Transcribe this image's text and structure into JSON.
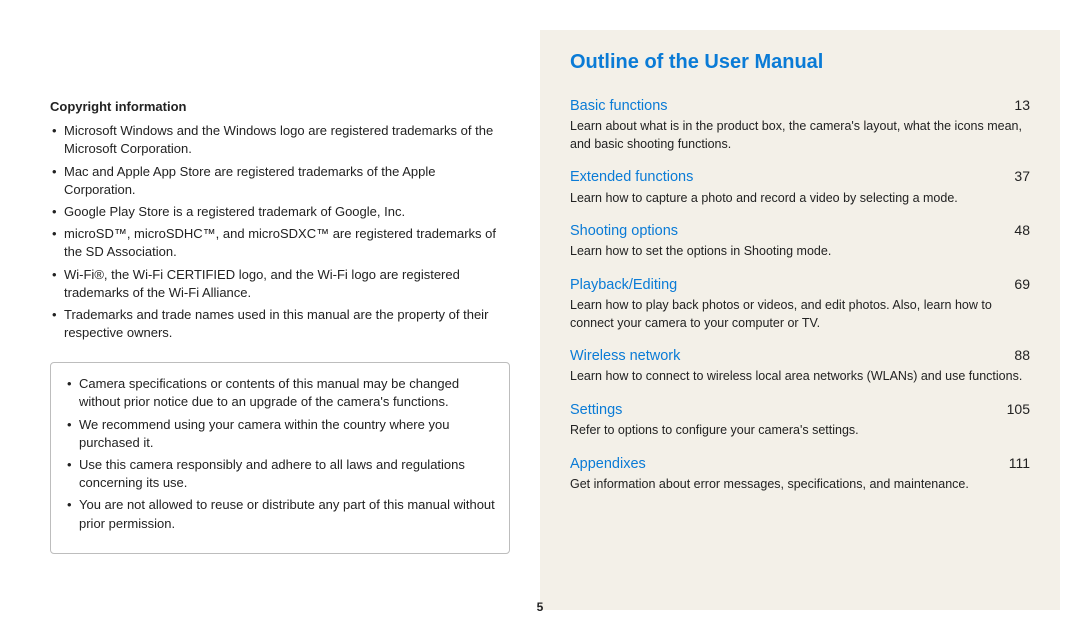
{
  "left": {
    "copyright_heading": "Copyright information",
    "copyright_items": [
      "Microsoft Windows and the Windows logo are registered trademarks of the Microsoft Corporation.",
      "Mac and Apple App Store are registered trademarks of the Apple Corporation.",
      "Google Play Store is a registered trademark of Google, Inc.",
      "microSD™, microSDHC™, and microSDXC™ are registered trademarks of the SD Association.",
      "Wi-Fi®, the Wi-Fi CERTIFIED logo, and the Wi-Fi logo are registered trademarks of the Wi-Fi Alliance.",
      "Trademarks and trade names used in this manual are the property of their respective owners."
    ],
    "notice_items": [
      "Camera specifications or contents of this manual may be changed without prior notice due to an upgrade of the camera's functions.",
      "We recommend using your camera within the country where you purchased it.",
      "Use this camera responsibly and adhere to all laws and regulations concerning its use.",
      "You are not allowed to reuse or distribute any part of this manual without prior permission."
    ]
  },
  "right": {
    "title": "Outline of the User Manual",
    "sections": [
      {
        "title": "Basic functions",
        "page": "13",
        "desc": "Learn about what is in the product box, the camera's layout, what the icons mean, and basic shooting functions."
      },
      {
        "title": "Extended functions",
        "page": "37",
        "desc": "Learn how to capture a photo and record a video by selecting a mode."
      },
      {
        "title": "Shooting options",
        "page": "48",
        "desc": "Learn how to set the options in Shooting mode."
      },
      {
        "title": "Playback/Editing",
        "page": "69",
        "desc": "Learn how to play back photos or videos, and edit photos. Also, learn how to connect your camera to your computer or TV."
      },
      {
        "title": "Wireless network",
        "page": "88",
        "desc": "Learn how to connect to wireless local area networks (WLANs) and use functions."
      },
      {
        "title": "Settings",
        "page": "105",
        "desc": "Refer to options to configure your camera's settings."
      },
      {
        "title": "Appendixes",
        "page": "111",
        "desc": "Get information about error messages, specifications, and maintenance."
      }
    ]
  },
  "page_number": "5"
}
